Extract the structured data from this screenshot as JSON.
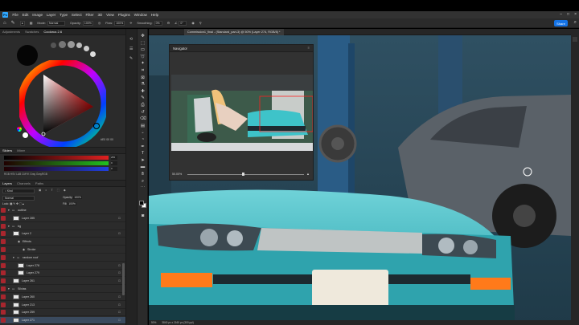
{
  "menu": {
    "logo": "Ps",
    "items": [
      "File",
      "Edit",
      "Image",
      "Layer",
      "Type",
      "Select",
      "Filter",
      "3D",
      "View",
      "Plugins",
      "Window",
      "Help"
    ]
  },
  "options": {
    "mode_label": "Mode:",
    "mode_value": "Normal",
    "opacity_label": "Opacity:",
    "opacity_value": "100%",
    "flow_label": "Flow:",
    "flow_value": "100%",
    "smoothing_label": "Smoothing:",
    "smoothing_value": "0%",
    "angle_value": "0°"
  },
  "share_label": "Share",
  "document": {
    "tab_title": "Commission1_final - (Standard_part-3) @ 50% (Layer 274, RGB/8) *"
  },
  "color_panel": {
    "tabs": [
      "Adjustments",
      "Swatches",
      "Coolorus 2.6"
    ],
    "hex_readout": "#E0 00 00"
  },
  "sliders": {
    "tabs": [
      "Sliders",
      "Mixer"
    ],
    "rows": [
      {
        "channel": "R",
        "value": "255",
        "color": "#e02020"
      },
      {
        "channel": "G",
        "value": "0",
        "color": "#20c020"
      },
      {
        "channel": "B",
        "value": "0",
        "color": "#2040e0"
      }
    ],
    "mode_tabs": "RGB  HSV  LAB  CMYK  Gray  GrayRGB"
  },
  "layers_panel": {
    "tabs": [
      "Layers",
      "Channels",
      "Paths"
    ],
    "kind_label": "Kind",
    "blend_mode": "Normal",
    "opacity_label": "Opacity:",
    "opacity_value": "100%",
    "lock_label": "Lock:",
    "fill_label": "Fill:",
    "fill_value": "100%",
    "rows": [
      {
        "name": "outline",
        "type": "group",
        "indent": 0,
        "visible": true
      },
      {
        "name": "Layer 285",
        "type": "layer",
        "indent": 1,
        "visible": true
      },
      {
        "name": "bg",
        "type": "group",
        "indent": 0,
        "visible": true
      },
      {
        "name": "Layer 2",
        "type": "layer",
        "indent": 1,
        "visible": true
      },
      {
        "name": "Effects",
        "type": "fx",
        "indent": 2,
        "visible": true
      },
      {
        "name": "Stroke",
        "type": "fx",
        "indent": 3,
        "visible": true
      },
      {
        "name": "random roof",
        "type": "group",
        "indent": 1,
        "visible": true
      },
      {
        "name": "Layer 278",
        "type": "layer",
        "indent": 2,
        "visible": true
      },
      {
        "name": "Layer 279",
        "type": "layer",
        "indent": 2,
        "visible": true
      },
      {
        "name": "Layer 261",
        "type": "layer",
        "indent": 1,
        "visible": true
      },
      {
        "name": "Silvias",
        "type": "group",
        "indent": 0,
        "visible": true
      },
      {
        "name": "Layer 260",
        "type": "layer",
        "indent": 1,
        "visible": true
      },
      {
        "name": "Layer 213",
        "type": "layer",
        "indent": 1,
        "visible": true
      },
      {
        "name": "Layer 259",
        "type": "layer",
        "indent": 1,
        "visible": true
      },
      {
        "name": "Layer 271",
        "type": "layer",
        "indent": 1,
        "visible": true
      }
    ]
  },
  "navigator": {
    "title": "Navigator",
    "zoom": "50.00%"
  },
  "status": {
    "zoom": "50%",
    "doc_size": "3840 px x 2160 px (300 ppi)"
  },
  "colors": {
    "accent": "#31a8ff",
    "share": "#1473e6",
    "car_teal": "#35b7c0",
    "layer_eye": "#a8262e"
  }
}
